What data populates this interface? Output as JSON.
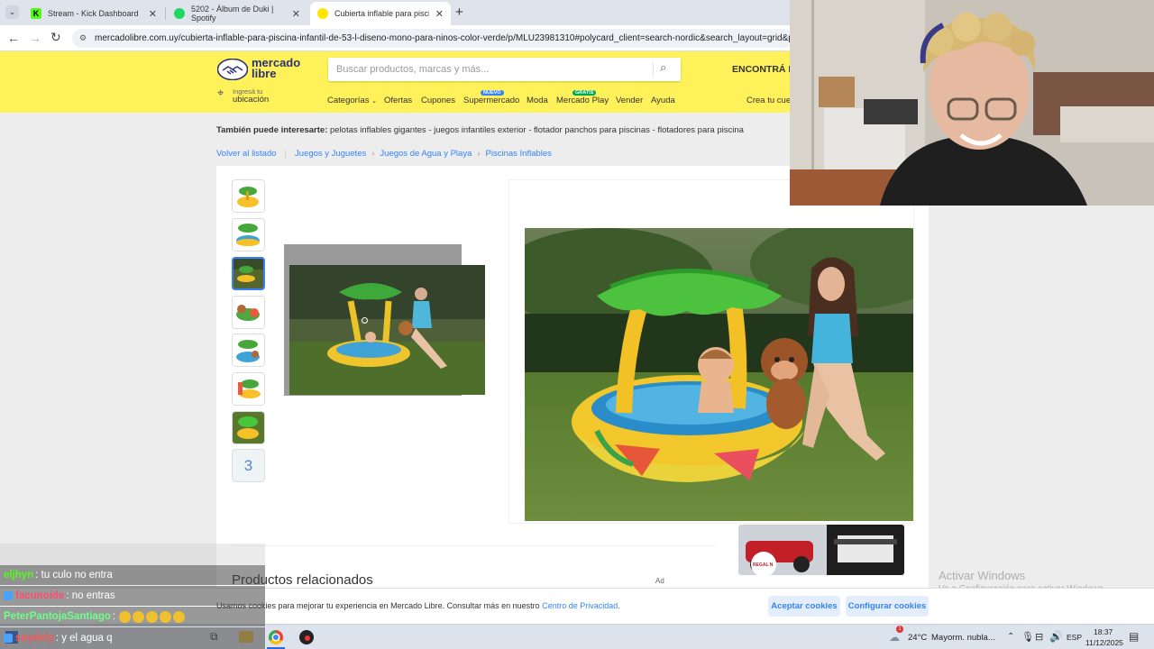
{
  "browser": {
    "tabs": [
      {
        "title": "Stream - Kick Dashboard",
        "favicon_color": "#53fc18"
      },
      {
        "title": "5202 - Álbum de Duki | Spotify",
        "favicon_color": "#1ed760"
      },
      {
        "title": "Cubierta inflable para piscina in",
        "favicon_color": "#ffe600"
      }
    ],
    "url": "mercadolibre.com.uy/cubierta-inflable-para-piscina-infantil-de-53-l-diseno-mono-para-ninos-color-verde/p/MLU23981310#polycard_client=search-nordic&search_layout=grid&position="
  },
  "ml": {
    "logo_line1": "mercado",
    "logo_line2": "libre",
    "search_placeholder": "Buscar productos, marcas y más...",
    "promo": "ENCONTRÁ E",
    "location_small": "Ingresá tu",
    "location_main": "ubicación",
    "nav": [
      {
        "label": "Categorías"
      },
      {
        "label": "Ofertas"
      },
      {
        "label": "Cupones"
      },
      {
        "label": "Supermercado",
        "badge": "NUEVO"
      },
      {
        "label": "Moda"
      },
      {
        "label": "Mercado Play",
        "badge": "GRATIS"
      },
      {
        "label": "Vender"
      },
      {
        "label": "Ayuda"
      }
    ],
    "account_link": "Crea tu cue",
    "interest_label": "También puede interesarte:",
    "interest_items": "pelotas inflables gigantes - juegos infantiles exterior - flotador panchos para piscinas - flotadores para piscina",
    "back_link": "Volver al listado",
    "breadcrumbs": [
      "Juegos y Juguetes",
      "Juegos de Agua y Playa",
      "Piscinas Inflables"
    ],
    "thumb_count_label": "3",
    "related_title": "Productos relacionados",
    "ad_label": "Ad",
    "ad_banner_text": "REGAL N"
  },
  "cookie": {
    "text": "Usamos cookies para mejorar tu experiencia en Mercado Libre. Consultar más en nuestro",
    "link": "Centro de Privacidad.",
    "accept": "Aceptar cookies",
    "configure": "Configurar cookies"
  },
  "watermark": {
    "line1": "Activar Windows",
    "line2": "Ve a Configuración para activar Windows."
  },
  "chat": [
    {
      "user": "eljhyn",
      "message": ": tu culo no entra",
      "color": "#53fc18"
    },
    {
      "user": "facunoide",
      "message": ": no entras",
      "color": "#ff4d6d"
    },
    {
      "user": "PeterPantojaSantiago",
      "message": ":",
      "color": "#6dff8a"
    },
    {
      "user": "soydely",
      "message": ": y el agua q",
      "color": "#ff5252"
    }
  ],
  "taskbar": {
    "weather": "24°C",
    "weather_desc": "Mayorm. nubla...",
    "lang": "ESP",
    "time": "18:37",
    "date": "11/12/2025",
    "notif_count": "1"
  }
}
